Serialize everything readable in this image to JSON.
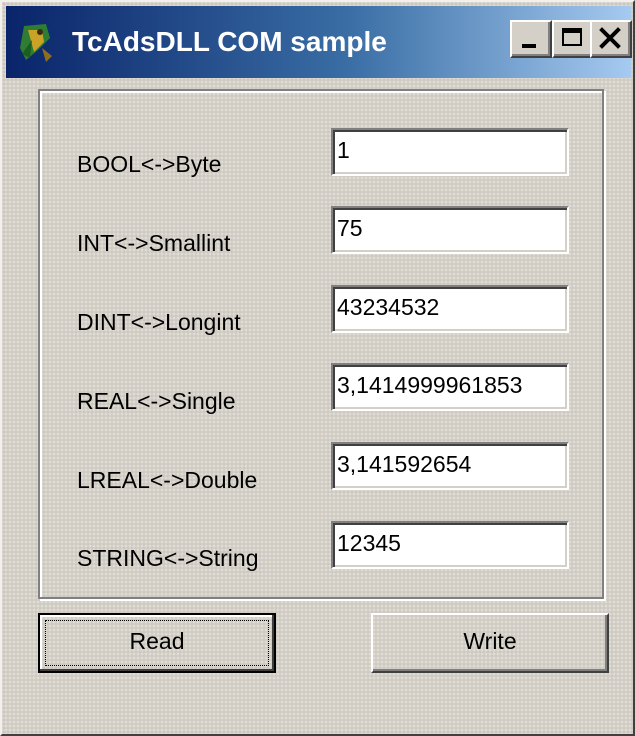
{
  "window": {
    "title": "TcAdsDLL COM sample",
    "accent_color": "#0a246a",
    "app_icon": "twincat-figure-icon"
  },
  "title_buttons": {
    "minimize_icon": "minimize-icon",
    "maximize_icon": "maximize-icon",
    "close_icon": "close-icon"
  },
  "fields": [
    {
      "label": "BOOL<->Byte",
      "value": "1"
    },
    {
      "label": "INT<->Smallint",
      "value": "75"
    },
    {
      "label": "DINT<->Longint",
      "value": "43234532"
    },
    {
      "label": "REAL<->Single",
      "value": "3,1414999961853"
    },
    {
      "label": "LREAL<->Double",
      "value": "3,141592654"
    },
    {
      "label": "STRING<->String",
      "value": "12345"
    }
  ],
  "buttons": {
    "read_label": "Read",
    "write_label": "Write"
  }
}
